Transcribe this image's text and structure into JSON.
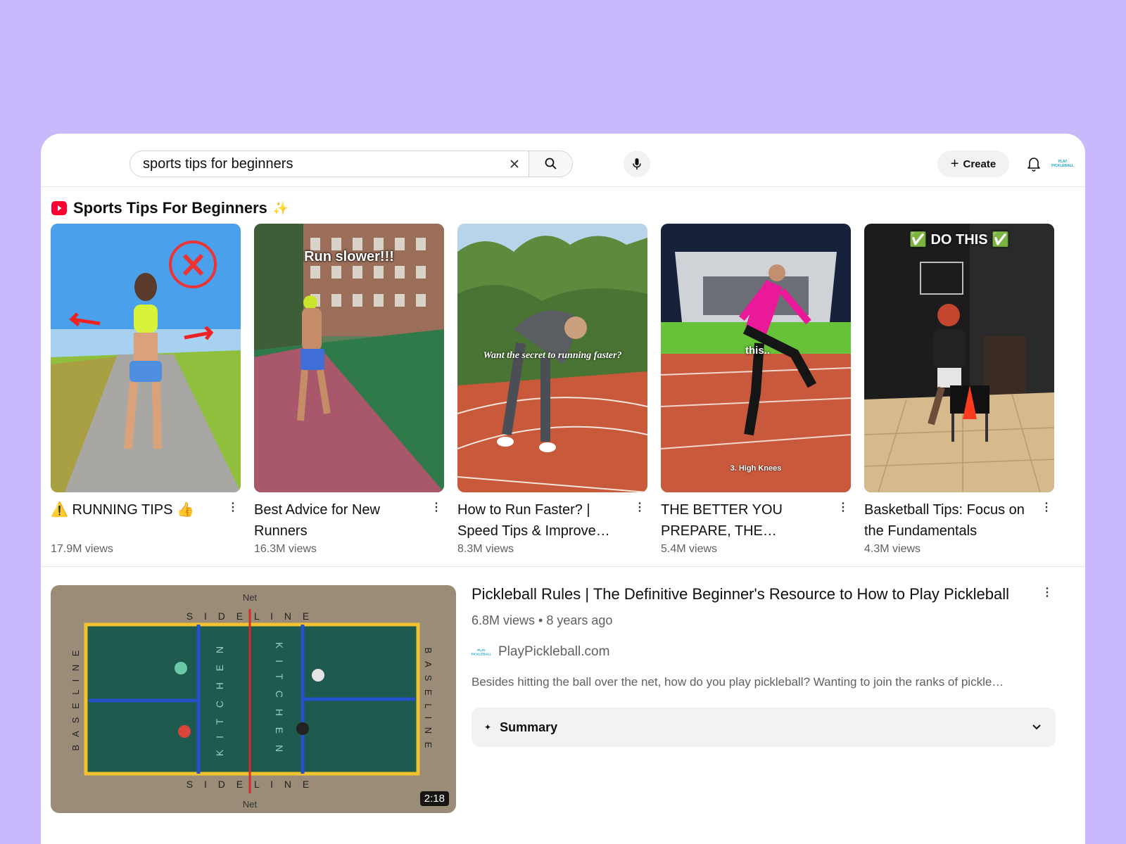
{
  "search": {
    "query": "sports tips for beginners"
  },
  "header": {
    "create_label": "Create",
    "avatar_text": "PLAY PICKLEBALL"
  },
  "shelf": {
    "title": "Sports Tips For Beginners",
    "sparkle": "✨",
    "shorts": [
      {
        "title": "⚠️ RUNNING TIPS 👍",
        "views": "17.9M views",
        "overlay": ""
      },
      {
        "title": "Best Advice for New Runners",
        "views": "16.3M views",
        "overlay": "Run slower!!!"
      },
      {
        "title": "How to Run Faster? | Speed Tips & Improve…",
        "views": "8.3M views",
        "overlay": "Want the secret to running faster?"
      },
      {
        "title": "THE BETTER YOU PREPARE, THE FASTER…",
        "views": "5.4M views",
        "overlay": "this..",
        "overlay2": "3. High Knees"
      },
      {
        "title": "Basketball Tips: Focus on the Fundamentals",
        "views": "4.3M views",
        "overlay": "✅ DO THIS ✅"
      }
    ]
  },
  "video": {
    "title": "Pickleball Rules | The Definitive Beginner's Resource to How to Play Pickleball",
    "meta": "6.8M views • 8 years ago",
    "channel": "PlayPickleball.com",
    "description": "Besides hitting the ball over the net, how do you play pickleball? Wanting to join the ranks of pickle…",
    "duration": "2:18",
    "court_labels": {
      "net": "Net",
      "sideline": "S I D E   L I N E",
      "baseline": "B A S E   L I N E",
      "kitchen": "K I T C H E N"
    },
    "summary_label": "Summary"
  }
}
